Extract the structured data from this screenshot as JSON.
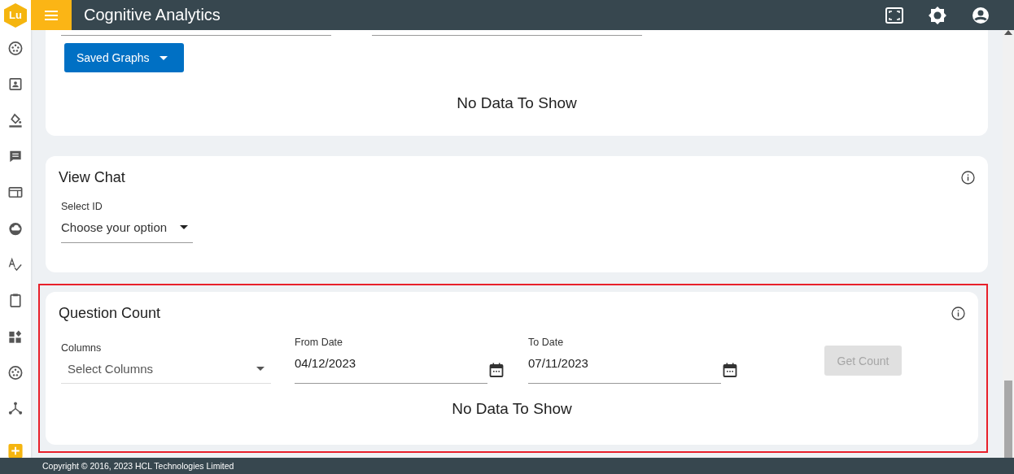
{
  "app": {
    "logo": "Lu",
    "title": "Cognitive Analytics"
  },
  "graphs_card": {
    "button": "Saved Graphs",
    "empty": "No Data To Show"
  },
  "view_chat": {
    "title": "View Chat",
    "select_label": "Select ID",
    "select_value": "Choose your option"
  },
  "question_count": {
    "title": "Question Count",
    "highlighted": true,
    "columns": {
      "label": "Columns",
      "placeholder": "Select Columns"
    },
    "from_date": {
      "label": "From Date",
      "value": "04/12/2023"
    },
    "to_date": {
      "label": "To Date",
      "value": "07/11/2023"
    },
    "button": {
      "label": "Get Count",
      "disabled": true
    },
    "empty": "No Data To Show"
  },
  "footer": "Copyright © 2016, 2023 HCL Technologies Limited"
}
